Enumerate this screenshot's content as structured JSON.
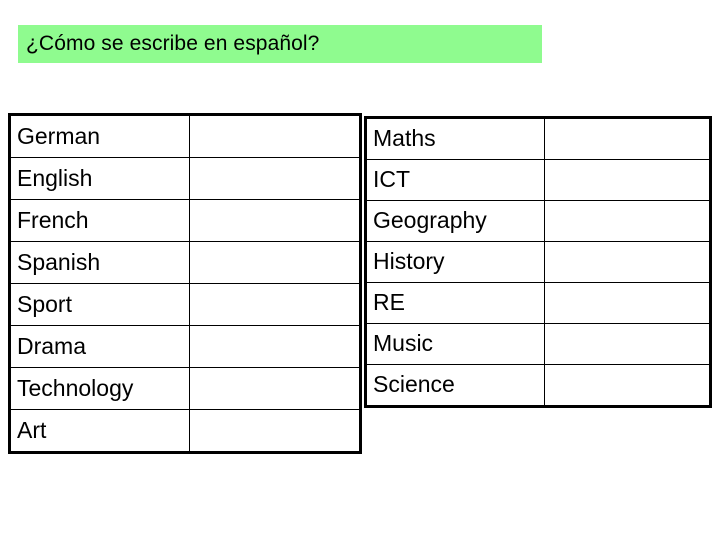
{
  "slide": {
    "background_color": "#ffffff",
    "title": {
      "text": "¿Cómo se escribe en español?",
      "highlight_color": "#8ffb8f",
      "text_color": "#000000"
    }
  },
  "tables": {
    "border_color": "#000000",
    "left": {
      "name": "left-subject-table",
      "rows": [
        {
          "label": "German",
          "answer": ""
        },
        {
          "label": "English",
          "answer": ""
        },
        {
          "label": "French",
          "answer": ""
        },
        {
          "label": "Spanish",
          "answer": ""
        },
        {
          "label": "Sport",
          "answer": ""
        },
        {
          "label": "Drama",
          "answer": ""
        },
        {
          "label": "Technology",
          "answer": ""
        },
        {
          "label": "Art",
          "answer": ""
        }
      ]
    },
    "right": {
      "name": "right-subject-table",
      "rows": [
        {
          "label": "Maths",
          "answer": ""
        },
        {
          "label": "ICT",
          "answer": ""
        },
        {
          "label": "Geography",
          "answer": ""
        },
        {
          "label": "History",
          "answer": ""
        },
        {
          "label": "RE",
          "answer": ""
        },
        {
          "label": "Music",
          "answer": ""
        },
        {
          "label": "Science",
          "answer": ""
        }
      ]
    }
  }
}
